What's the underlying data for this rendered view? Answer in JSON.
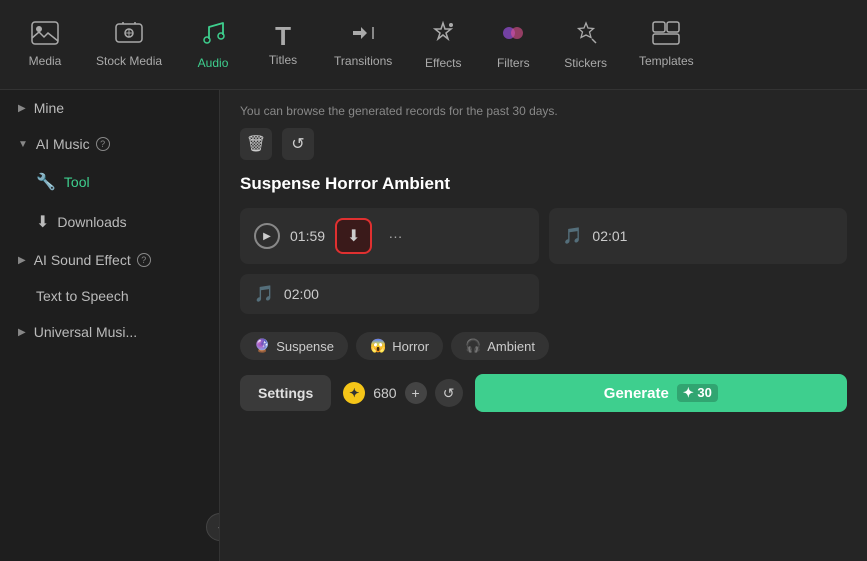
{
  "nav": {
    "items": [
      {
        "id": "media",
        "label": "Media",
        "icon": "🖼",
        "active": false
      },
      {
        "id": "stock-media",
        "label": "Stock Media",
        "icon": "📷",
        "active": false
      },
      {
        "id": "audio",
        "label": "Audio",
        "icon": "🎵",
        "active": true
      },
      {
        "id": "titles",
        "label": "Titles",
        "icon": "T",
        "active": false
      },
      {
        "id": "transitions",
        "label": "Transitions",
        "icon": "↔",
        "active": false
      },
      {
        "id": "effects",
        "label": "Effects",
        "icon": "✨",
        "active": false
      },
      {
        "id": "filters",
        "label": "Filters",
        "icon": "🎨",
        "active": false
      },
      {
        "id": "stickers",
        "label": "Stickers",
        "icon": "💫",
        "active": false
      },
      {
        "id": "templates",
        "label": "Templates",
        "icon": "⊞",
        "active": false
      }
    ]
  },
  "sidebar": {
    "mine_label": "Mine",
    "ai_music_label": "AI Music",
    "tool_label": "Tool",
    "downloads_label": "Downloads",
    "ai_sound_effect_label": "AI Sound Effect",
    "text_to_speech_label": "Text to Speech",
    "universal_music_label": "Universal Musi...",
    "collapse_icon": "‹"
  },
  "content": {
    "browse_notice": "You can browse the generated records for the past 30 days.",
    "track_title": "Suspense Horror Ambient",
    "tracks": [
      {
        "id": 1,
        "duration": "01:59",
        "has_play": true,
        "has_download": true,
        "has_more": true
      },
      {
        "id": 2,
        "duration": "02:01",
        "has_play": false,
        "has_music": true
      },
      {
        "id": 3,
        "duration": "02:00",
        "has_play": false,
        "has_music": true
      }
    ],
    "tags": [
      {
        "id": "suspense",
        "icon": "🔮",
        "label": "Suspense"
      },
      {
        "id": "horror",
        "icon": "😱",
        "label": "Horror"
      },
      {
        "id": "ambient",
        "icon": "🎧",
        "label": "Ambient"
      }
    ],
    "settings_btn": "Settings",
    "credits_value": "680",
    "plus_symbol": "+",
    "generate_btn": "Generate",
    "generate_count": "30",
    "delete_icon": "🗑",
    "refresh_icon": "↺"
  }
}
